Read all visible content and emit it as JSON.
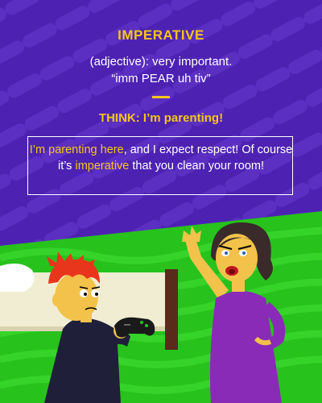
{
  "word": "IMPERATIVE",
  "definition": "(adjective): very important.",
  "pronunciation": "“imm PEAR uh tiv”",
  "think": "THINK: I’m parenting!",
  "example": {
    "hl1": "I’m parenting here",
    "t1": ", and I expect respect! Of course it’s ",
    "hl2": "imperative",
    "t2": " that you clean your room!"
  },
  "colors": {
    "background": "#4d22b3",
    "accent": "#f5c518",
    "grass": "#27c21c",
    "text": "#ffffff"
  },
  "illustration": {
    "scene": "mother scolding son",
    "icons": [
      "game-controller-icon",
      "bed-icon",
      "door-frame-icon"
    ]
  }
}
